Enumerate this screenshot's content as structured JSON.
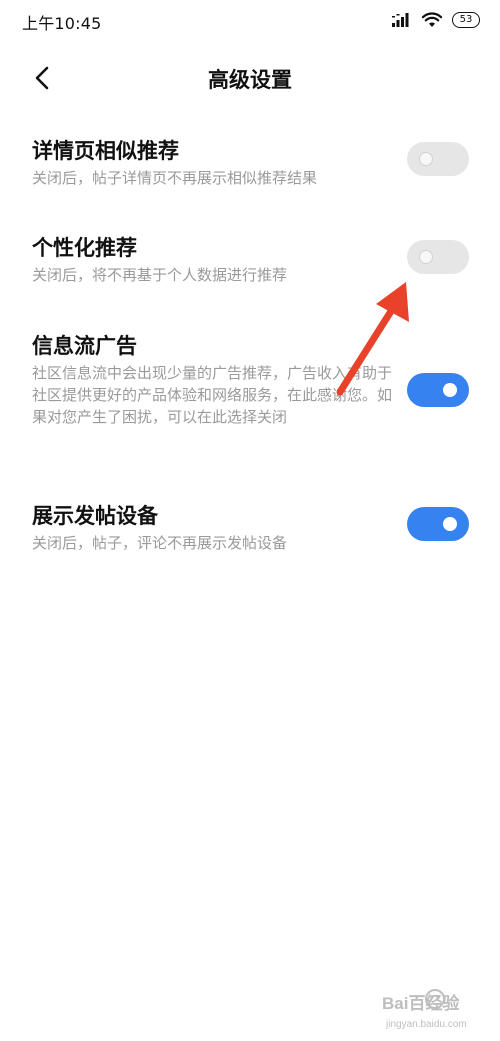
{
  "status_bar": {
    "time": "上午10:45",
    "battery": "53",
    "icons": [
      "signal-icon",
      "wifi-icon",
      "battery-icon"
    ]
  },
  "header": {
    "back_icon": "chevron-left-icon",
    "title": "高级设置"
  },
  "settings": [
    {
      "title": "详情页相似推荐",
      "description": "关闭后，帖子详情页不再展示相似推荐结果",
      "enabled": false
    },
    {
      "title": "个性化推荐",
      "description": "关闭后，将不再基于个人数据进行推荐",
      "enabled": false
    },
    {
      "title": "信息流广告",
      "description": "社区信息流中会出现少量的广告推荐，广告收入有助于社区提供更好的产品体验和网络服务，在此感谢您。如果对您产生了困扰，可以在此选择关闭",
      "enabled": true
    },
    {
      "title": "展示发帖设备",
      "description": "关闭后，帖子，评论不再展示发帖设备",
      "enabled": true
    }
  ],
  "colors": {
    "toggle_on": "#3582f0",
    "toggle_off": "#e6e6e6",
    "annotation_arrow": "#e8422b"
  },
  "watermark": {
    "logo": "Bai百经验",
    "url": "jingyan.baidu.com"
  }
}
